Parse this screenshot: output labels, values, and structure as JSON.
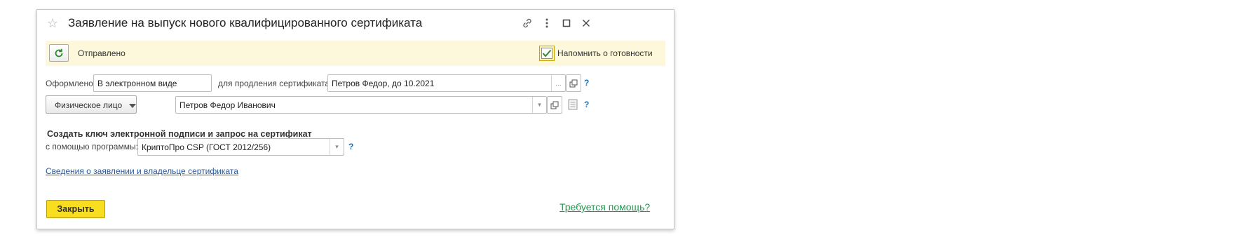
{
  "window": {
    "title": "Заявление на выпуск нового квалифицированного сертификата"
  },
  "banner": {
    "status": "Отправлено",
    "remind_label": "Напомнить о готовности",
    "remind_checked": true
  },
  "row1": {
    "issued_label": "Оформлено:",
    "issued_value": "В электронном виде",
    "renewal_label": "для продления сертификата:",
    "renewal_value": "Петров Федор, до 10.2021",
    "help": "?"
  },
  "row2": {
    "owner_type": "Физическое лицо",
    "owner_name": "Петров Федор Иванович",
    "help": "?"
  },
  "key_section": {
    "heading": "Создать ключ электронной подписи и запрос на сертификат",
    "program_label": "с помощью программы:",
    "program_value": "КриптоПро CSP (ГОСТ 2012/256)",
    "help": "?"
  },
  "details_link": "Сведения о заявлении и владельце сертификата",
  "footer": {
    "close_label": "Закрыть",
    "help_link": "Требуется помощь?"
  },
  "colors": {
    "banner_bg": "#fdf8dc",
    "primary_button": "#f8dd20",
    "link": "#2a5a9a",
    "help_link": "#1e9a4c",
    "help_mark": "#1f6fb2"
  }
}
